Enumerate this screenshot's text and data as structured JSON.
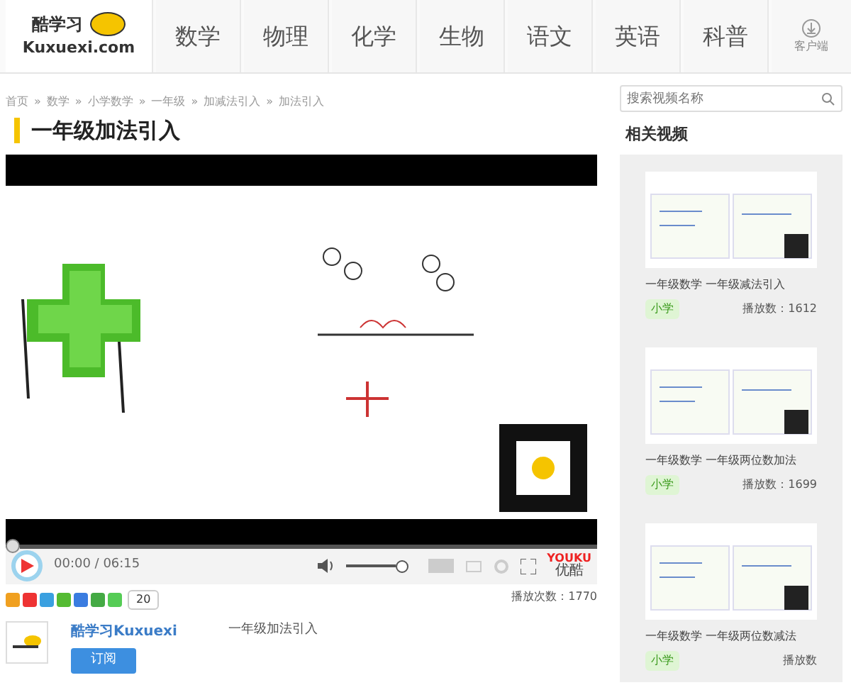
{
  "header": {
    "logo_text": "酷学习",
    "logo_domain": "Kuxuexi.com",
    "nav": [
      {
        "label": "数学"
      },
      {
        "label": "物理"
      },
      {
        "label": "化学"
      },
      {
        "label": "生物"
      },
      {
        "label": "语文"
      },
      {
        "label": "英语"
      },
      {
        "label": "科普"
      }
    ],
    "client_label": "客户端"
  },
  "breadcrumb": [
    {
      "label": "首页"
    },
    {
      "separator": "»",
      "label": "数学"
    },
    {
      "separator": "»",
      "label": "小学数学"
    },
    {
      "separator": "»",
      "label": "一年级"
    },
    {
      "separator": "»",
      "label": "加减法引入"
    },
    {
      "separator": "»",
      "label": "加法引入"
    }
  ],
  "title": "一年级加法引入",
  "player": {
    "time": "00:00 / 06:15",
    "level": 0,
    "volume": {
      "level": 1
    },
    "brand_top": "YOUKU",
    "brand_bottom": "优酷"
  },
  "share": {
    "count": "20",
    "play_count": "播放次数：1770"
  },
  "author": {
    "name": "酷学习Kuxuexi",
    "subscribe": "订阅",
    "video_title": "一年级加法引入"
  },
  "sidebar": {
    "search_placeholder": "搜索视频名称",
    "heading": "相关视频",
    "videos": [
      {
        "title": "一年级数学 一年级减法引入",
        "tag": "小学",
        "plays": "播放数：1612"
      },
      {
        "title": "一年级数学 一年级两位数加法",
        "tag": "小学",
        "plays": "播放数：1699"
      },
      {
        "title": "一年级数学 一年级两位数减法",
        "tag": "小学",
        "plays": "播放数"
      }
    ]
  }
}
